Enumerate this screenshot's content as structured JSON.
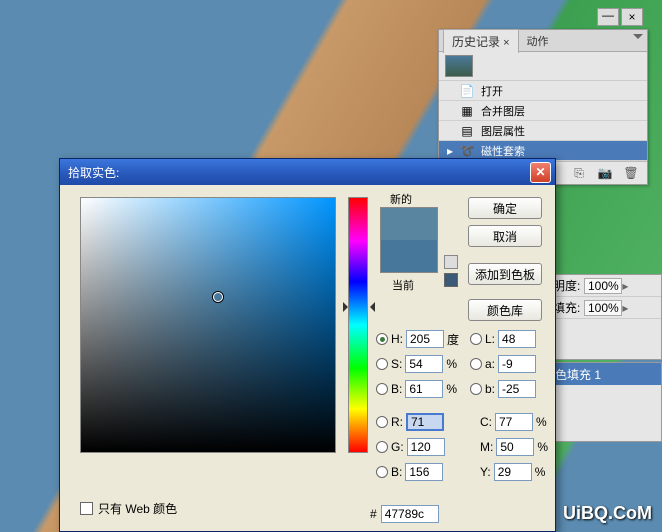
{
  "watermark": "UiBQ.CoM",
  "history": {
    "tabs": {
      "history": "历史记录",
      "actions": "动作"
    },
    "items": [
      {
        "label": "打开",
        "icon": "open"
      },
      {
        "label": "合并图层",
        "icon": "merge"
      },
      {
        "label": "图层属性",
        "icon": "props"
      },
      {
        "label": "磁性套索",
        "icon": "lasso",
        "selected": true
      }
    ]
  },
  "side": {
    "opacity_label": "明度:",
    "opacity_value": "100%",
    "fill_label": "填充:",
    "fill_value": "100%",
    "fill_layer": "色填充 1"
  },
  "dialog": {
    "title": "拾取实色:",
    "new_label": "新的",
    "current_label": "当前",
    "ok": "确定",
    "cancel": "取消",
    "add_swatch": "添加到色板",
    "color_lib": "颜色库",
    "hsb": {
      "H": {
        "label": "H:",
        "value": "205",
        "unit": "度"
      },
      "S": {
        "label": "S:",
        "value": "54",
        "unit": "%"
      },
      "B": {
        "label": "B:",
        "value": "61",
        "unit": "%"
      }
    },
    "lab": {
      "L": {
        "label": "L:",
        "value": "48"
      },
      "a": {
        "label": "a:",
        "value": "-9"
      },
      "b": {
        "label": "b:",
        "value": "-25"
      }
    },
    "rgb": {
      "R": {
        "label": "R:",
        "value": "71"
      },
      "G": {
        "label": "G:",
        "value": "120"
      },
      "B": {
        "label": "B:",
        "value": "156"
      }
    },
    "cmyk": {
      "C": {
        "label": "C:",
        "value": "77",
        "unit": "%"
      },
      "M": {
        "label": "M:",
        "value": "50",
        "unit": "%"
      },
      "Y": {
        "label": "Y:",
        "value": "29",
        "unit": "%"
      }
    },
    "hex": {
      "label": "#",
      "value": "47789c"
    },
    "web_only": "只有 Web 颜色",
    "colors": {
      "new": "#5a85a0",
      "current": "#47789c"
    },
    "cursor": {
      "s_pct": 54,
      "b_pct": 61,
      "hue_pos_pct": 43
    }
  }
}
